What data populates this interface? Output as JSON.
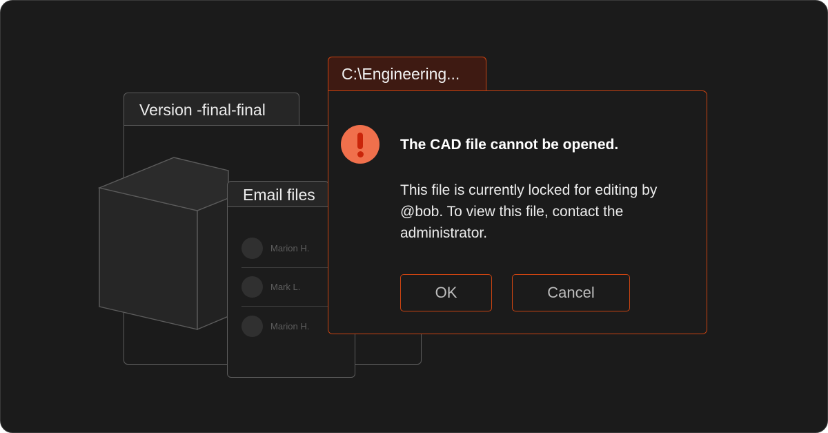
{
  "version_window": {
    "title": "Version -final-final"
  },
  "email_window": {
    "title": "Email files",
    "items": [
      {
        "name": "Marion H."
      },
      {
        "name": "Mark L."
      },
      {
        "name": "Marion H."
      }
    ]
  },
  "dialog": {
    "tab_title": "C:\\Engineering...",
    "title": "The CAD file cannot be opened.",
    "message": "This file is currently locked for editing by @bob. To view this file, contact the administrator.",
    "ok_label": "OK",
    "cancel_label": "Cancel",
    "icon": "alert-icon"
  },
  "colors": {
    "background": "#1b1b1b",
    "accent": "#cc4411",
    "alert": "#f0704c",
    "dialog_tab": "#3e1a12"
  }
}
